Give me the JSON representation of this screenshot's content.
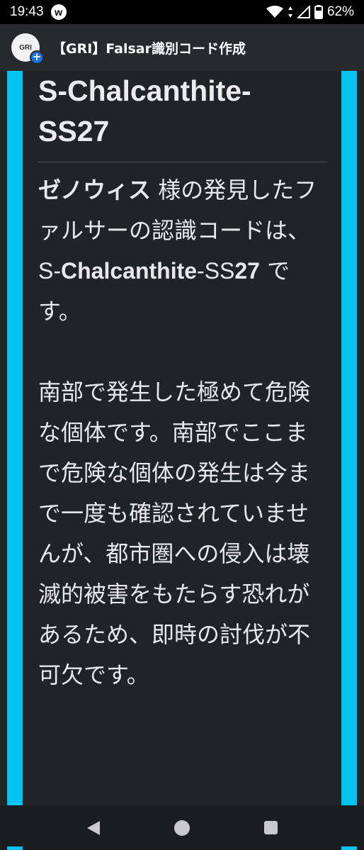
{
  "status": {
    "time": "19:43",
    "notif_glyph": "w",
    "battery": "62%",
    "icons": [
      "wifi-icon",
      "signal-icon",
      "battery-icon"
    ]
  },
  "app": {
    "logo_text": "GRI",
    "title": "【GRI】Falsar識別コード作成"
  },
  "content": {
    "title_line1": "S-Chalcanthite-",
    "title_line2": "SS27",
    "name": "ゼノウィス",
    "intro_rest": " 様の発見したファルサーの認識コードは、",
    "code_prefix": "S-",
    "code_main": "Chalcanthite",
    "code_mid": "-SS",
    "code_num": "27",
    "code_suffix": " です。",
    "paragraph2": "南部で発生した極めて危険な個体です。南部でここまで危険な個体の発生は今まで一度も確認されていませんが、都市圏への侵入は壊滅的被害をもたらす恐れがあるため、即時の討伐が不可欠です。"
  },
  "colors": {
    "accent": "#00c3f2",
    "appbar": "#27292d",
    "background": "#222326"
  },
  "nav": {
    "icons": [
      "back-icon",
      "home-icon",
      "recents-icon"
    ]
  }
}
